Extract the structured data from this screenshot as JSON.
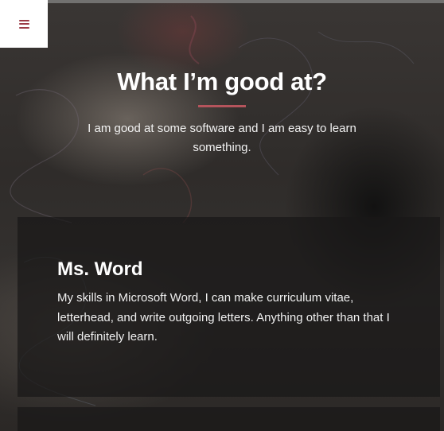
{
  "nav": {
    "menu_icon": "hamburger-menu-icon",
    "accent_color": "#9b3a45"
  },
  "section": {
    "title": "What I’m good at?",
    "subtitle": "I am good at some software and I am easy to learn something.",
    "divider_color": "#b5545c"
  },
  "skills": [
    {
      "title": "Ms. Word",
      "description": "My skills in Microsoft Word, I can make curriculum vitae, letterhead, and write outgoing letters. Anything other than that I will definitely learn."
    }
  ]
}
